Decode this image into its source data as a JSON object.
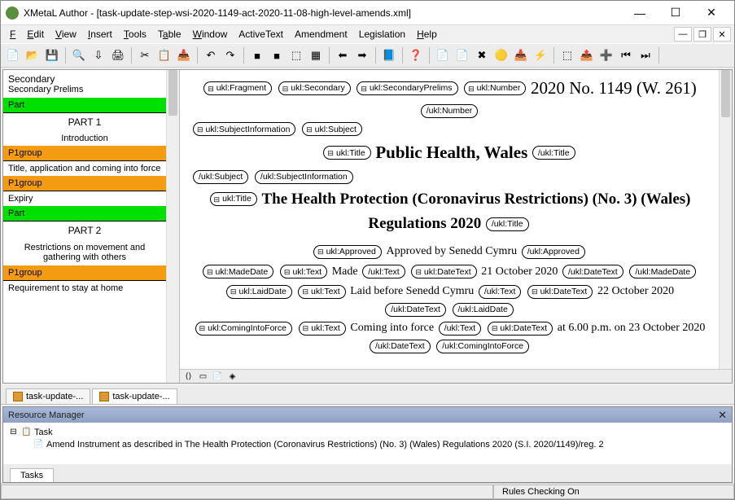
{
  "window": {
    "title": "XMetaL Author - [task-update-step-wsi-2020-1149-act-2020-11-08-high-level-amends.xml]"
  },
  "menus": [
    "File",
    "Edit",
    "View",
    "Insert",
    "Tools",
    "Table",
    "Window",
    "ActiveText",
    "Amendment",
    "Legislation",
    "Help"
  ],
  "toolbar_icons": [
    "📄",
    "📂",
    "💾",
    "|",
    "🔍",
    "⇩",
    "🖨",
    "|",
    "✂",
    "📋",
    "📥",
    "|",
    "↶",
    "↷",
    "|",
    "■",
    "■",
    "⬚",
    "▦",
    "|",
    "⬅",
    "➡",
    "|",
    "📘",
    "|",
    "❓",
    "|",
    "📄",
    "📄",
    "✖",
    "🟡",
    "📥",
    "⚡",
    "|",
    "⬚",
    "📤",
    "➕",
    "⏮",
    "⏭",
    "|"
  ],
  "sidebar": {
    "title": "Secondary",
    "subtitle": "Secondary Prelims",
    "items": [
      {
        "type": "part",
        "label": "Part"
      },
      {
        "type": "heading",
        "label": "PART 1"
      },
      {
        "type": "intro",
        "label": "Introduction"
      },
      {
        "type": "p1group",
        "label": "P1group"
      },
      {
        "type": "text",
        "label": "Title, application and coming into force"
      },
      {
        "type": "p1group",
        "label": "P1group"
      },
      {
        "type": "text",
        "label": "Expiry"
      },
      {
        "type": "part",
        "label": "Part"
      },
      {
        "type": "heading",
        "label": "PART 2"
      },
      {
        "type": "restrict",
        "label": "Restrictions on movement and gathering with others"
      },
      {
        "type": "p1group",
        "label": "P1group"
      },
      {
        "type": "text",
        "label": "Requirement to stay at home"
      }
    ]
  },
  "document": {
    "tags": {
      "fragment": "ukl:Fragment",
      "secondary": "ukl:Secondary",
      "secPrelims": "ukl:SecondaryPrelims",
      "number": "ukl:Number",
      "numberClose": "/ukl:Number",
      "subjInfo": "ukl:SubjectInformation",
      "subj": "ukl:Subject",
      "title": "ukl:Title",
      "titleClose": "/ukl:Title",
      "subjClose": "/ukl:Subject",
      "subjInfoClose": "/ukl:SubjectInformation",
      "approved": "ukl:Approved",
      "approvedClose": "/ukl:Approved",
      "madeDate": "ukl:MadeDate",
      "madeDateClose": "/ukl:MadeDate",
      "text": "ukl:Text",
      "textClose": "/ukl:Text",
      "dateText": "ukl:DateText",
      "dateTextClose": "/ukl:DateText",
      "laidDate": "ukl:LaidDate",
      "laidDateClose": "/ukl:LaidDate",
      "cif": "ukl:ComingIntoForce",
      "cifClose": "/ukl:ComingIntoForce"
    },
    "siNumber": "2020 No. 1149 (W. 261)",
    "subjectTitle": "Public Health, Wales",
    "mainTitle": "The Health Protection (Coronavirus Restrictions) (No. 3) (Wales) Regulations 2020",
    "approved": "Approved by Senedd Cymru",
    "made_label": "Made",
    "made_date": "21 October 2020",
    "laid_label": "Laid before Senedd Cymru",
    "laid_date": "22 October 2020",
    "cif_label": "Coming into force",
    "cif_date": "at 6.00 p.m. on 23 October 2020"
  },
  "doctabs": [
    "task-update-...",
    "task-update-..."
  ],
  "rm": {
    "title": "Resource Manager",
    "task": "Task",
    "task_desc": "Amend Instrument as described in The Health Protection (Coronavirus Restrictions) (No. 3) (Wales) Regulations 2020 (S.I. 2020/1149)/reg. 2",
    "tab": "Tasks"
  },
  "status": {
    "rules": "Rules Checking On"
  }
}
